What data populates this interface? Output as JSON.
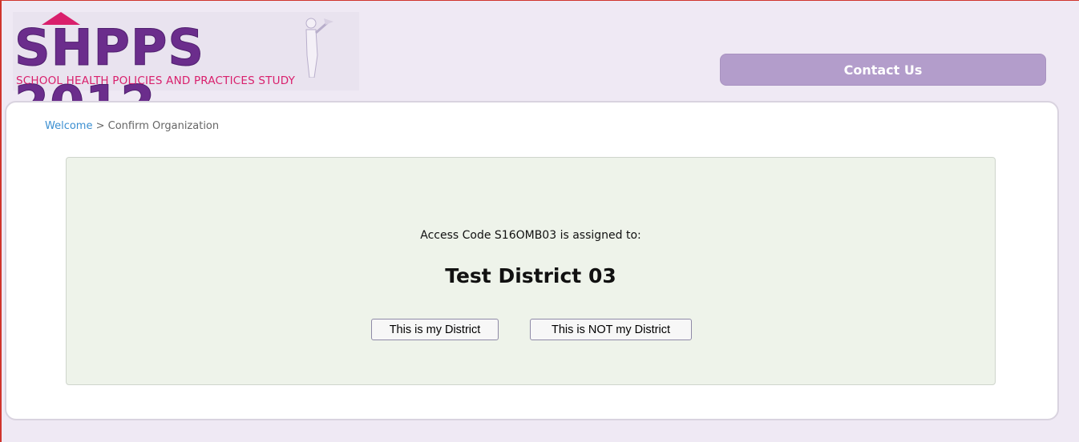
{
  "logo": {
    "title": "SHPPS 2012",
    "subtitle": "SCHOOL HEALTH POLICIES AND PRACTICES STUDY"
  },
  "header": {
    "contact_label": "Contact Us"
  },
  "breadcrumb": {
    "home_label": "Welcome",
    "separator": " > ",
    "current_label": "Confirm Organization"
  },
  "card": {
    "assigned_text": "Access Code S16OMB03 is assigned to:",
    "district_name": "Test District 03",
    "confirm_label": "This is my District",
    "reject_label": "This is NOT my District"
  },
  "colors": {
    "brand_purple": "#6b2d8c",
    "brand_pink": "#d91f6c",
    "contact_button": "#b39dcb",
    "card_background": "#eef3ea",
    "page_background": "#efe9f4",
    "link_blue": "#3b8fd1"
  }
}
